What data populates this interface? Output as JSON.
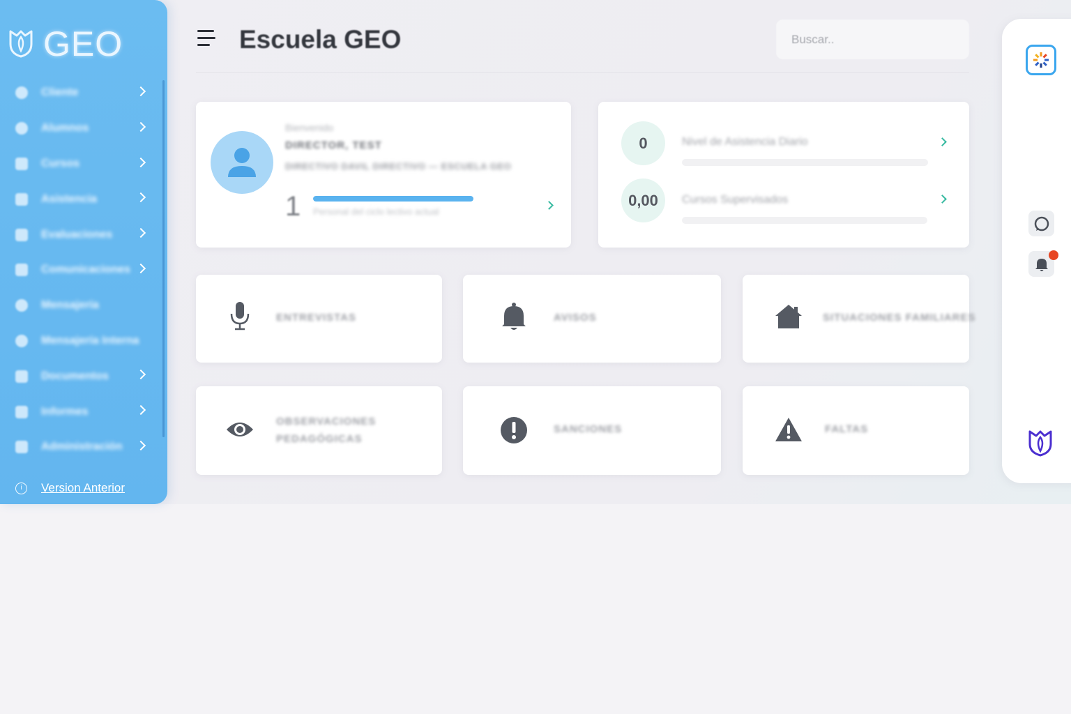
{
  "app": {
    "logo_text": "GEO",
    "title": "Escuela GEO"
  },
  "search": {
    "placeholder": "Buscar.."
  },
  "sidebar": {
    "items": [
      {
        "label": "Cliente",
        "icon": "user-icon",
        "has_chevron": true
      },
      {
        "label": "Alumnos",
        "icon": "user-icon",
        "has_chevron": true
      },
      {
        "label": "Cursos",
        "icon": "calendar-icon",
        "has_chevron": true
      },
      {
        "label": "Asistencia",
        "icon": "checklist-icon",
        "has_chevron": true
      },
      {
        "label": "Evaluaciones",
        "icon": "clipboard-icon",
        "has_chevron": true
      },
      {
        "label": "Comunicaciones",
        "icon": "list-icon",
        "has_chevron": true
      },
      {
        "label": "Mensajería",
        "icon": "message-icon",
        "has_chevron": false
      },
      {
        "label": "Mensajería Interna",
        "icon": "location-icon",
        "has_chevron": false
      },
      {
        "label": "Documentos",
        "icon": "document-icon",
        "has_chevron": true
      },
      {
        "label": "Informes",
        "icon": "chart-icon",
        "has_chevron": true
      },
      {
        "label": "Administración",
        "icon": "building-icon",
        "has_chevron": true
      }
    ],
    "version_link": "Version Anterior"
  },
  "profile": {
    "greeting": "Bienvenido",
    "name": "DIRECTOR, TEST",
    "school": "DIRECTIVO DAVIL DIRECTIVO — ESCUELA GEO",
    "count": "1",
    "progress": 1.0,
    "caption": "Personal del ciclo lectivo actual"
  },
  "stats": [
    {
      "value": "0",
      "label": "Nivel de Asistencia Diario"
    },
    {
      "value": "0,00",
      "label": "Cursos Supervisados"
    }
  ],
  "tiles": [
    {
      "label": "ENTREVISTAS",
      "icon": "microphone-icon"
    },
    {
      "label": "AVISOS",
      "icon": "bell-icon"
    },
    {
      "label": "SITUACIONES FAMILIARES",
      "icon": "house-icon"
    },
    {
      "label": "OBSERVACIONES PEDAGÓGICAS",
      "icon": "eye-icon"
    },
    {
      "label": "SANCIONES",
      "icon": "exclamation-circle-icon"
    },
    {
      "label": "FALTAS",
      "icon": "warning-triangle-icon"
    }
  ],
  "rail": {
    "icons": [
      "app-badge-icon",
      "chat-icon",
      "bell-icon",
      "geo-logo-icon"
    ],
    "notification_dot_color": "#e74623"
  },
  "colors": {
    "sidebar": "#63b6ef",
    "accent_teal": "#35b9a0",
    "progress_blue": "#5ab3ef",
    "rail_badge_border": "#3aa6ee",
    "logo_purple": "#4b2fd0"
  }
}
